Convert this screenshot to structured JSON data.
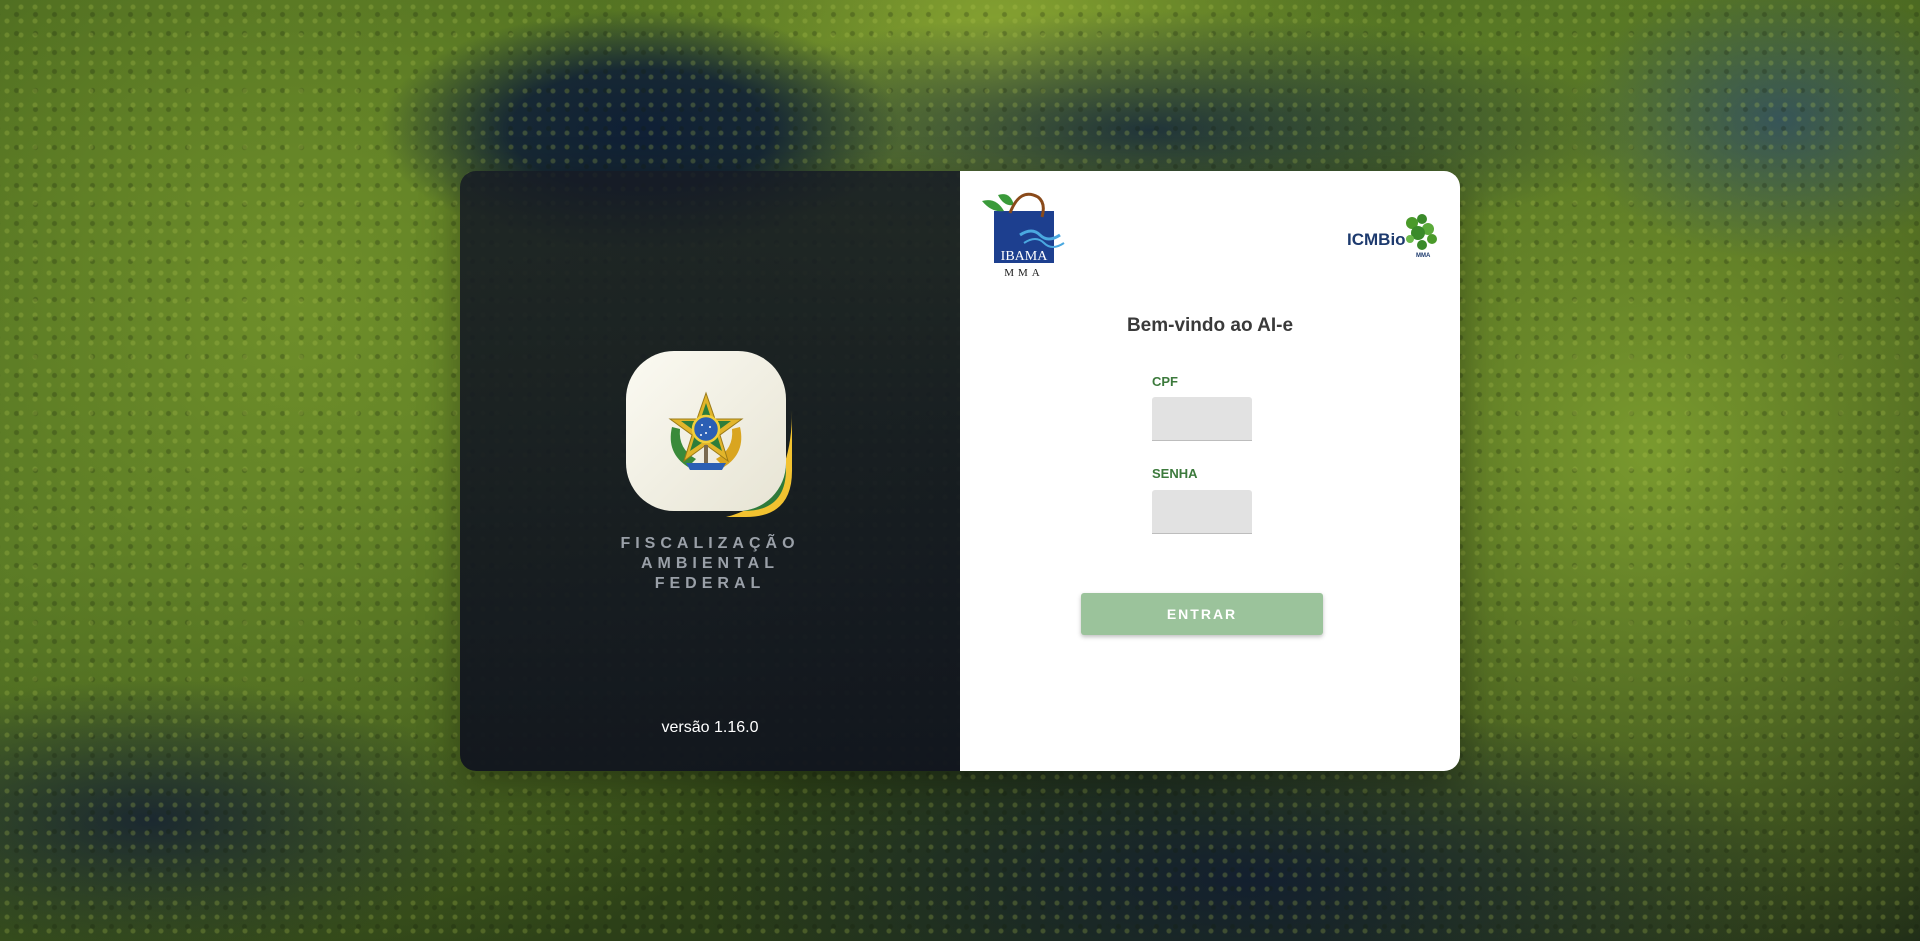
{
  "brand": {
    "tagline_lines": [
      "FISCALIZAÇÃO",
      "AMBIENTAL",
      "FEDERAL"
    ],
    "version": "versão 1.16.0",
    "emblem_icon": "brazil-coat-of-arms-icon"
  },
  "logos": {
    "ibama_text": "IBAMA",
    "ibama_subtext": "MMA",
    "icmbio_text": "ICMBio",
    "icmbio_subtext": "MMA"
  },
  "login": {
    "title": "Bem-vindo ao AI-e",
    "cpf_label": "CPF",
    "cpf_value": "",
    "password_label": "SENHA",
    "password_value": "",
    "submit_label": "ENTRAR"
  },
  "colors": {
    "accent_green": "#3c7a3c",
    "button_disabled": "#9bc39b",
    "panel_dark": "#161b24"
  }
}
